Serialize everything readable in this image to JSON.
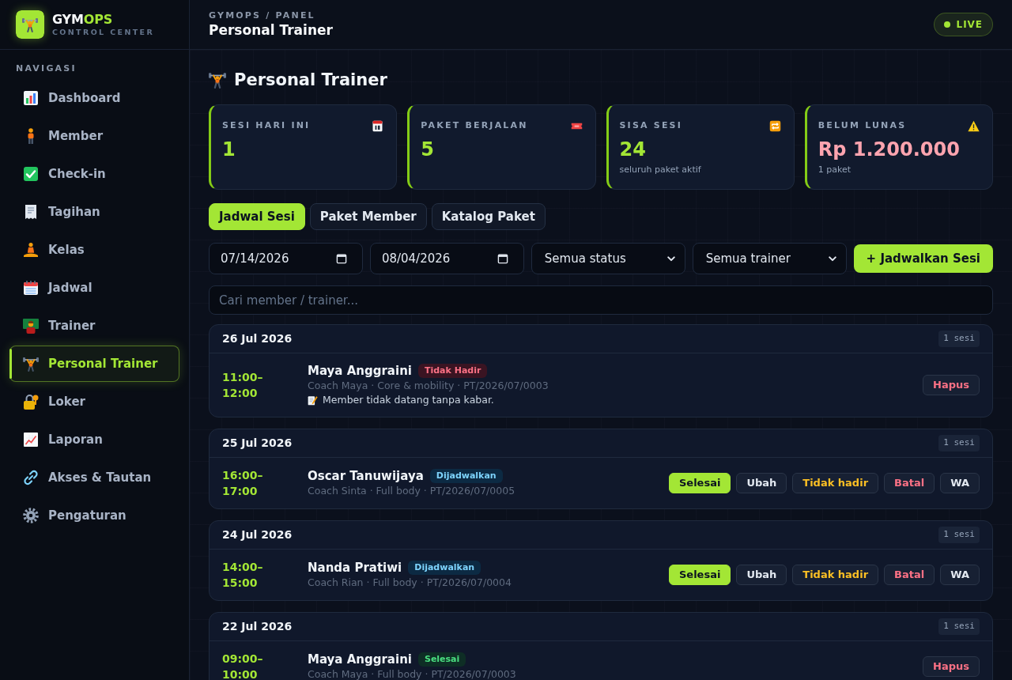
{
  "sidebar": {
    "brand": {
      "name_start": "GYM",
      "name_end": "OPS",
      "tagline": "CONTROL CENTER"
    },
    "section_label": "NAVIGASI",
    "items": [
      {
        "label": "Dashboard",
        "selected": false
      },
      {
        "label": "Member",
        "selected": false
      },
      {
        "label": "Check-in",
        "selected": false
      },
      {
        "label": "Tagihan",
        "selected": false
      },
      {
        "label": "Kelas",
        "selected": false
      },
      {
        "label": "Jadwal",
        "selected": false
      },
      {
        "label": "Trainer",
        "selected": false
      },
      {
        "label": "Personal Trainer",
        "selected": true
      },
      {
        "label": "Loker",
        "selected": false
      },
      {
        "label": "Laporan",
        "selected": false
      },
      {
        "label": "Akses & Tautan",
        "selected": false
      },
      {
        "label": "Pengaturan",
        "selected": false
      }
    ]
  },
  "header": {
    "breadcrumb": "GYMOPS / PANEL",
    "title": "Personal Trainer",
    "live_badge": "LIVE"
  },
  "page_title": "Personal Trainer",
  "stats": [
    {
      "label": "SESI HARI INI",
      "value": "1",
      "color": "#a3e635"
    },
    {
      "label": "PAKET BERJALAN",
      "value": "5",
      "color": "#a3e635"
    },
    {
      "label": "SISA SESI",
      "value": "24",
      "note": "seluruh paket aktif",
      "color": "#a3e635"
    },
    {
      "label": "BELUM LUNAS",
      "value": "Rp 1.200.000",
      "note": "1 paket",
      "color": "#fda4af"
    }
  ],
  "tabs": [
    {
      "label": "Jadwal Sesi",
      "selected": true
    },
    {
      "label": "Paket Member",
      "selected": false
    },
    {
      "label": "Katalog Paket",
      "selected": false
    }
  ],
  "filters": {
    "date_from": "07/14/2026",
    "date_to": "08/04/2026",
    "status": "Semua status",
    "trainer": "Semua trainer",
    "add_button": "+ Jadwalkan Sesi"
  },
  "search": {
    "placeholder": "Cari member / trainer..."
  },
  "groups": [
    {
      "date": "26 Jul 2026",
      "count": "1 sesi",
      "sessions": [
        {
          "time": "11:00–12:00",
          "member": "Maya Anggraini",
          "status": {
            "label": "Tidak Hadir",
            "kind": "absent"
          },
          "details": "Coach Maya · Core & mobility · PT/2026/07/0003",
          "note": "Member tidak datang tanpa kabar.",
          "actions": [
            {
              "label": "Hapus",
              "kind": "danger"
            }
          ]
        }
      ]
    },
    {
      "date": "25 Jul 2026",
      "count": "1 sesi",
      "sessions": [
        {
          "time": "16:00–17:00",
          "member": "Oscar Tanuwijaya",
          "status": {
            "label": "Dijadwalkan",
            "kind": "scheduled"
          },
          "details": "Coach Sinta · Full body · PT/2026/07/0005",
          "actions": [
            {
              "label": "Selesai",
              "kind": "primary"
            },
            {
              "label": "Ubah",
              "kind": "neutral"
            },
            {
              "label": "Tidak hadir",
              "kind": "warning"
            },
            {
              "label": "Batal",
              "kind": "danger"
            },
            {
              "label": "WA",
              "kind": "neutral"
            }
          ]
        }
      ]
    },
    {
      "date": "24 Jul 2026",
      "count": "1 sesi",
      "sessions": [
        {
          "time": "14:00–15:00",
          "member": "Nanda Pratiwi",
          "status": {
            "label": "Dijadwalkan",
            "kind": "scheduled"
          },
          "details": "Coach Rian · Full body · PT/2026/07/0004",
          "actions": [
            {
              "label": "Selesai",
              "kind": "primary"
            },
            {
              "label": "Ubah",
              "kind": "neutral"
            },
            {
              "label": "Tidak hadir",
              "kind": "warning"
            },
            {
              "label": "Batal",
              "kind": "danger"
            },
            {
              "label": "WA",
              "kind": "neutral"
            }
          ]
        }
      ]
    },
    {
      "date": "22 Jul 2026",
      "count": "1 sesi",
      "sessions": [
        {
          "time": "09:00–10:00",
          "member": "Maya Anggraini",
          "status": {
            "label": "Selesai",
            "kind": "done"
          },
          "details": "Coach Maya · Full body · PT/2026/07/0003",
          "actions": [
            {
              "label": "Hapus",
              "kind": "danger"
            }
          ]
        }
      ]
    }
  ]
}
